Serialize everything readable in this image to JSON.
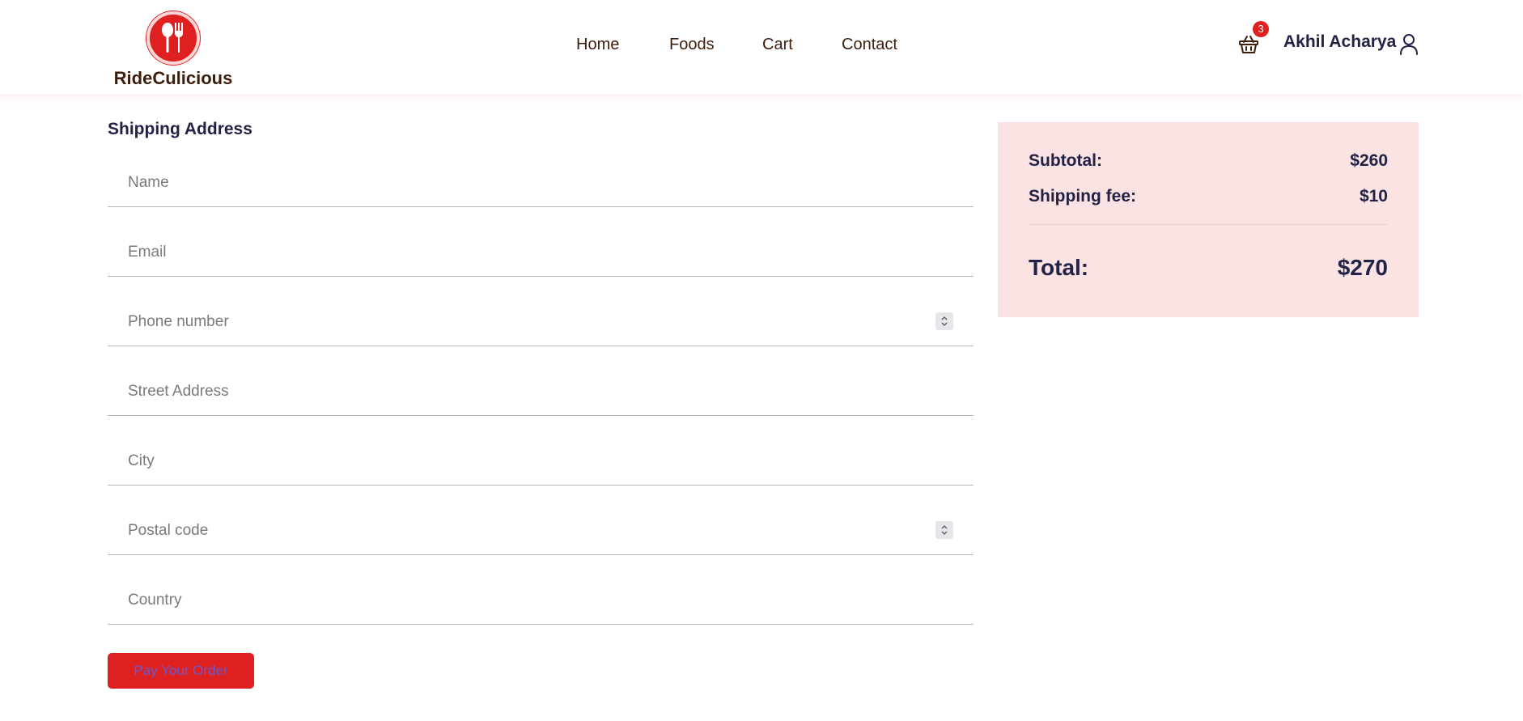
{
  "brand": {
    "name": "RideCulicious",
    "logo_icon": "spoon-fork-icon",
    "accent": "#df2020"
  },
  "nav": {
    "items": [
      {
        "label": "Home"
      },
      {
        "label": "Foods"
      },
      {
        "label": "Cart"
      },
      {
        "label": "Contact"
      }
    ]
  },
  "header": {
    "cart_count": "3",
    "user_name": "Akhil Acharya"
  },
  "shipping": {
    "title": "Shipping Address",
    "fields": {
      "name": {
        "placeholder": "Name",
        "value": ""
      },
      "email": {
        "placeholder": "Email",
        "value": ""
      },
      "phone": {
        "placeholder": "Phone number",
        "value": ""
      },
      "street": {
        "placeholder": "Street Address",
        "value": ""
      },
      "city": {
        "placeholder": "City",
        "value": ""
      },
      "postal": {
        "placeholder": "Postal code",
        "value": ""
      },
      "country": {
        "placeholder": "Country",
        "value": ""
      }
    },
    "pay_label": "Pay Your Order"
  },
  "summary": {
    "subtotal_label": "Subtotal:",
    "subtotal_value": "$260",
    "shipping_label": "Shipping fee:",
    "shipping_value": "$10",
    "total_label": "Total:",
    "total_value": "$270",
    "background": "#fce3e3"
  }
}
